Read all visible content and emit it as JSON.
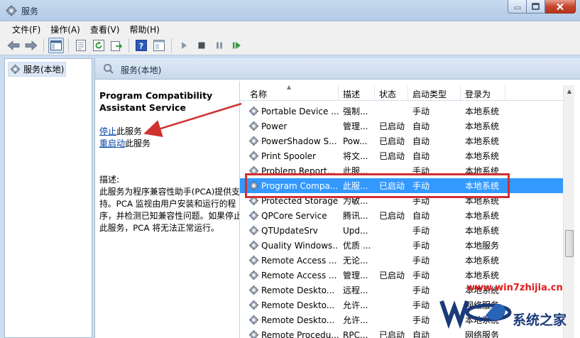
{
  "window": {
    "title": "服务"
  },
  "menu": [
    "文件(F)",
    "操作(A)",
    "查看(V)",
    "帮助(H)"
  ],
  "toolbar_icons": [
    "back-icon",
    "forward-icon",
    "show-tree-icon",
    "properties-icon",
    "refresh-icon",
    "export-icon",
    "help-icon",
    "view-icon",
    "start-service-icon",
    "stop-service-icon",
    "pause-service-icon",
    "restart-service-icon"
  ],
  "tree": {
    "node": "服务(本地)"
  },
  "panel": {
    "header": "服务(本地)"
  },
  "details": {
    "service_title": "Program Compatibility Assistant Service",
    "stop_link": "停止",
    "stop_suffix": "此服务",
    "restart_link": "重启动",
    "restart_suffix": "此服务",
    "desc_label": "描述:",
    "desc_body": "此服务为程序兼容性助手(PCA)提供支持。PCA 监视由用户安装和运行的程序，并检测已知兼容性问题。如果停止此服务，PCA 将无法正常运行。"
  },
  "columns": {
    "name": "名称",
    "desc": "描述",
    "status": "状态",
    "start": "启动类型",
    "logon": "登录为"
  },
  "services": [
    {
      "name": "Portable Device ...",
      "desc": "强制...",
      "status": "",
      "start": "手动",
      "logon": "本地系统"
    },
    {
      "name": "Power",
      "desc": "管理...",
      "status": "已启动",
      "start": "自动",
      "logon": "本地系统"
    },
    {
      "name": "PowerShadow S...",
      "desc": "Pow...",
      "status": "已启动",
      "start": "自动",
      "logon": "本地系统"
    },
    {
      "name": "Print Spooler",
      "desc": "将文...",
      "status": "已启动",
      "start": "自动",
      "logon": "本地系统"
    },
    {
      "name": "Problem Report...",
      "desc": "此服...",
      "status": "",
      "start": "手动",
      "logon": "本地系统"
    },
    {
      "name": "Program Compa...",
      "desc": "此服...",
      "status": "已启动",
      "start": "手动",
      "logon": "本地系统",
      "selected": true
    },
    {
      "name": "Protected Storage",
      "desc": "为敏...",
      "status": "",
      "start": "手动",
      "logon": "本地系统"
    },
    {
      "name": "QPCore Service",
      "desc": "腾讯...",
      "status": "已启动",
      "start": "自动",
      "logon": "本地系统"
    },
    {
      "name": "QTUpdateSrv",
      "desc": "Upd...",
      "status": "",
      "start": "手动",
      "logon": "本地系统"
    },
    {
      "name": "Quality Windows...",
      "desc": "优质 ...",
      "status": "",
      "start": "手动",
      "logon": "本地服务"
    },
    {
      "name": "Remote Access ...",
      "desc": "无论...",
      "status": "",
      "start": "手动",
      "logon": "本地系统"
    },
    {
      "name": "Remote Access ...",
      "desc": "管理...",
      "status": "已启动",
      "start": "手动",
      "logon": "本地系统"
    },
    {
      "name": "Remote Deskto...",
      "desc": "远程...",
      "status": "",
      "start": "手动",
      "logon": "本地系统"
    },
    {
      "name": "Remote Deskto...",
      "desc": "允许...",
      "status": "",
      "start": "手动",
      "logon": "网络服务"
    },
    {
      "name": "Remote Deskto...",
      "desc": "允许...",
      "status": "",
      "start": "手动",
      "logon": "本地系统"
    },
    {
      "name": "Remote Procedu...",
      "desc": "RPC...",
      "status": "已启动",
      "start": "自动",
      "logon": "网络服务"
    }
  ],
  "watermark": {
    "url": "www.win7zhijia.cn",
    "brand": "系统之家"
  },
  "colors": {
    "selection": "#3399ff",
    "annotation": "#d13030",
    "link": "#0645ad"
  }
}
